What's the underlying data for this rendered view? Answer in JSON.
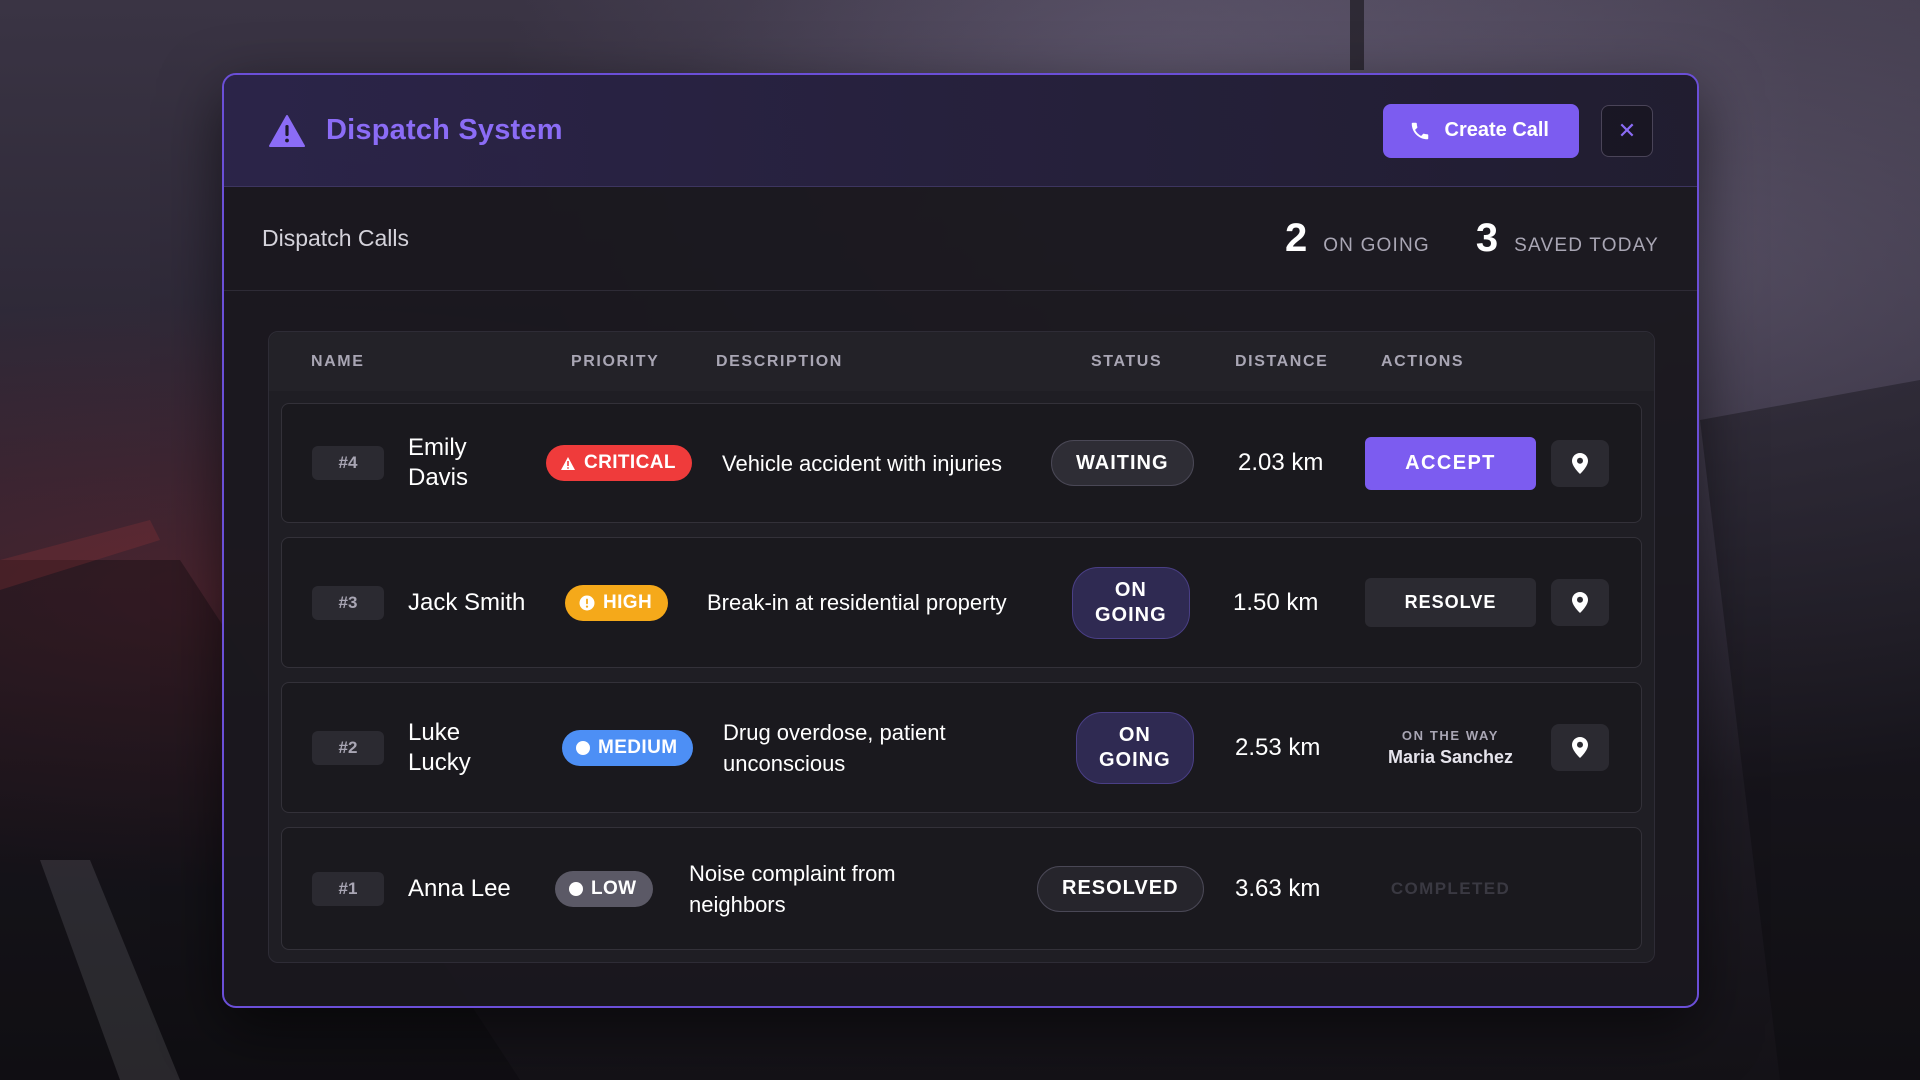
{
  "header": {
    "title": "Dispatch System",
    "create_call_label": "Create Call",
    "close_label": "✕"
  },
  "subbar": {
    "title": "Dispatch Calls",
    "stats": [
      {
        "value": "2",
        "label": "ON GOING"
      },
      {
        "value": "3",
        "label": "SAVED TODAY"
      }
    ]
  },
  "table": {
    "columns": [
      "NAME",
      "PRIORITY",
      "DESCRIPTION",
      "STATUS",
      "DISTANCE",
      "ACTIONS"
    ],
    "rows": [
      {
        "id": "#4",
        "name_line1": "Emily",
        "name_line2": "Davis",
        "priority": "CRITICAL",
        "description": "Vehicle accident with injuries",
        "status": "WAITING",
        "distance": "2.03 km",
        "action": "ACCEPT"
      },
      {
        "id": "#3",
        "name_line1": "Jack Smith",
        "priority": "HIGH",
        "description": "Break-in at residential property",
        "status_line1": "ON",
        "status_line2": "GOING",
        "distance": "1.50 km",
        "action": "RESOLVE"
      },
      {
        "id": "#2",
        "name_line1": "Luke",
        "name_line2": "Lucky",
        "priority": "MEDIUM",
        "description_line1": "Drug overdose, patient",
        "description_line2": "unconscious",
        "status_line1": "ON",
        "status_line2": "GOING",
        "distance": "2.53 km",
        "action_caption": "ON THE WAY",
        "action_person": "Maria Sanchez"
      },
      {
        "id": "#1",
        "name_line1": "Anna Lee",
        "priority": "LOW",
        "description_line1": "Noise complaint from",
        "description_line2": "neighbors",
        "status": "RESOLVED",
        "distance": "3.63 km",
        "action": "COMPLETED"
      }
    ]
  },
  "colors": {
    "accent": "#7c5cf0",
    "critical": "#ef3b3b",
    "high": "#f5a91a",
    "medium": "#4d8ff5",
    "low": "#5b5966"
  },
  "icons": {
    "header": "warning-triangle-icon",
    "create_call": "phone-icon",
    "close": "close-icon",
    "row_action": "map-pin-icon"
  }
}
